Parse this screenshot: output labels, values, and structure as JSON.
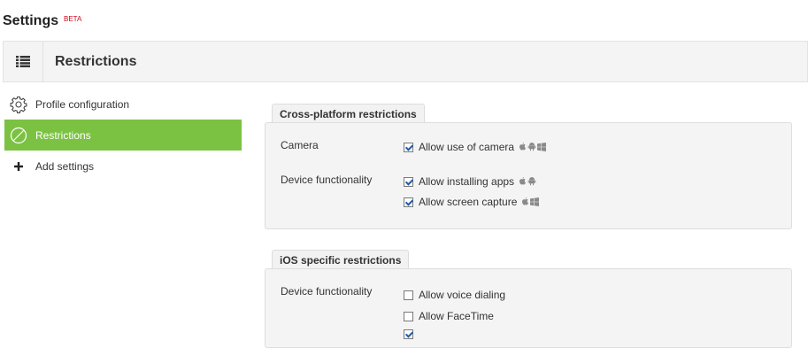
{
  "app": {
    "title": "Settings",
    "badge": "BETA"
  },
  "header": {
    "title": "Restrictions",
    "menu_icon": "list-icon"
  },
  "sidebar": {
    "items": [
      {
        "label": "Profile configuration",
        "icon": "gear-icon",
        "active": false
      },
      {
        "label": "Restrictions",
        "icon": "prohibited-icon",
        "active": true
      },
      {
        "label": "Add settings",
        "icon": "plus-icon",
        "active": false
      }
    ]
  },
  "sections": [
    {
      "title": "Cross-platform restrictions",
      "rows": [
        {
          "label": "Camera",
          "options": [
            {
              "label": "Allow use of camera",
              "checked": true,
              "platforms": [
                "apple",
                "android",
                "windows"
              ]
            }
          ]
        },
        {
          "label": "Device functionality",
          "options": [
            {
              "label": "Allow installing apps",
              "checked": true,
              "platforms": [
                "apple",
                "android"
              ]
            },
            {
              "label": "Allow screen capture",
              "checked": true,
              "platforms": [
                "apple",
                "windows"
              ]
            }
          ]
        }
      ]
    },
    {
      "title": "iOS specific restrictions",
      "rows": [
        {
          "label": "Device functionality",
          "options": [
            {
              "label": "Allow voice dialing",
              "checked": false
            },
            {
              "label": "Allow FaceTime",
              "checked": false
            },
            {
              "label": "",
              "checked": true
            }
          ]
        }
      ]
    }
  ],
  "colors": {
    "accent": "#7cc242",
    "badge": "#d0021b",
    "check": "#1c5ea8",
    "platform_icons": "#8a8a8a"
  }
}
